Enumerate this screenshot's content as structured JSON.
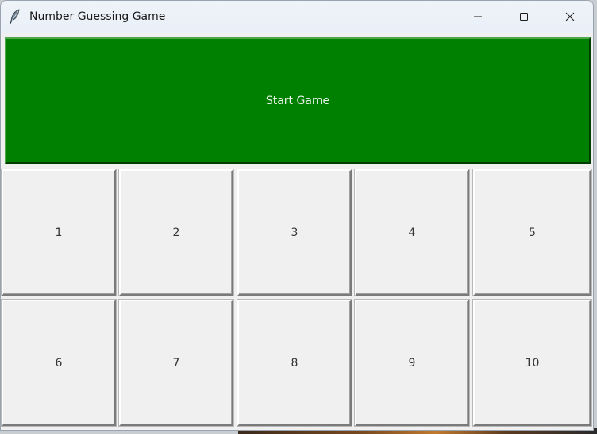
{
  "window": {
    "title": "Number Guessing Game",
    "app_icon": "feather-icon",
    "controls": {
      "minimize_icon": "minimize-icon",
      "maximize_icon": "maximize-icon",
      "close_icon": "close-icon"
    }
  },
  "game": {
    "start_label": "Start Game",
    "start_color": "#008000",
    "numbers": [
      "1",
      "2",
      "3",
      "4",
      "5",
      "6",
      "7",
      "8",
      "9",
      "10"
    ]
  }
}
